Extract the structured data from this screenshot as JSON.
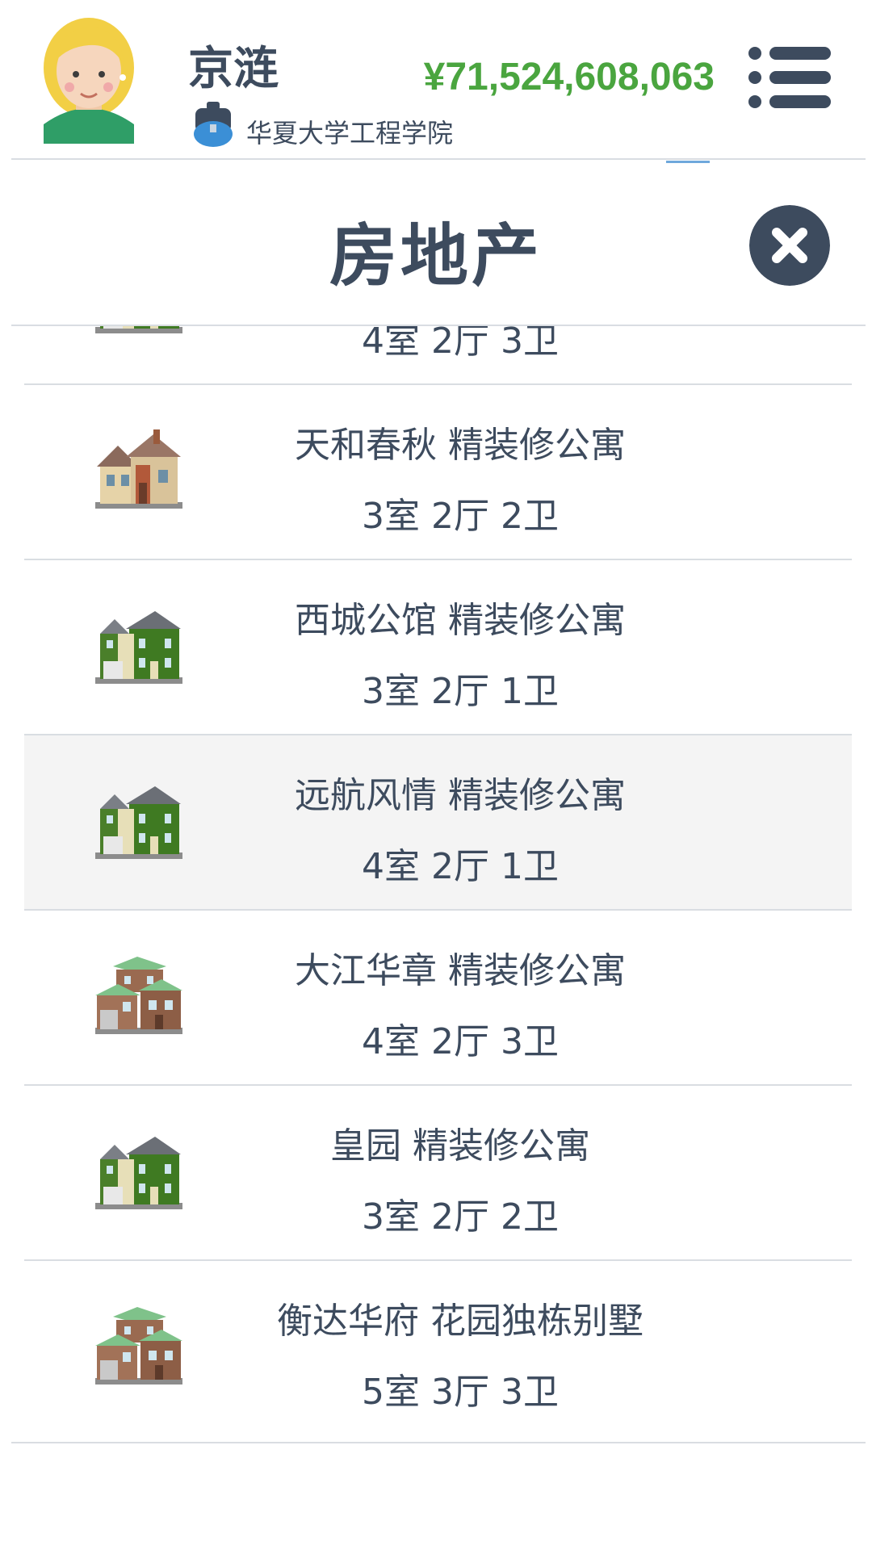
{
  "header": {
    "player_name": "京涟",
    "school": "华夏大学工程学院",
    "money": "¥71,524,608,063"
  },
  "panel": {
    "title": "房地产"
  },
  "properties": [
    {
      "name": "",
      "rooms": "4室 2厅 3卫",
      "icon": "green-house-icon"
    },
    {
      "name": "天和春秋 精装修公寓",
      "rooms": "3室 2厅 2卫",
      "icon": "tan-house-icon"
    },
    {
      "name": "西城公馆 精装修公寓",
      "rooms": "3室 2厅 1卫",
      "icon": "green-house-icon"
    },
    {
      "name": "远航风情 精装修公寓",
      "rooms": "4室 2厅 1卫",
      "icon": "green-house-icon"
    },
    {
      "name": "大江华章 精装修公寓",
      "rooms": "4室 2厅 3卫",
      "icon": "brown-house-icon"
    },
    {
      "name": "皇园 精装修公寓",
      "rooms": "3室 2厅 2卫",
      "icon": "green-house-icon"
    },
    {
      "name": "衡达华府 花园独栋别墅",
      "rooms": "5室 3厅 3卫",
      "icon": "brown-house-icon"
    }
  ],
  "colors": {
    "money": "#4aa53f",
    "text": "#3d4b5e",
    "highlight_row": "#f4f4f4"
  }
}
